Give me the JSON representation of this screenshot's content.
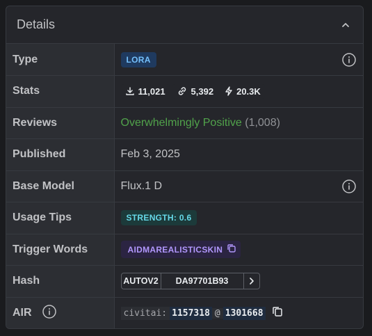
{
  "header": {
    "title": "Details"
  },
  "rows": {
    "type": {
      "label": "Type",
      "badge": "LORA"
    },
    "stats": {
      "label": "Stats",
      "downloads": "11,021",
      "links": "5,392",
      "buzz": "20.3K"
    },
    "reviews": {
      "label": "Reviews",
      "rating": "Overwhelmingly Positive",
      "count": "(1,008)"
    },
    "published": {
      "label": "Published",
      "date": "Feb 3, 2025"
    },
    "base_model": {
      "label": "Base Model",
      "value": "Flux.1 D"
    },
    "usage_tips": {
      "label": "Usage Tips",
      "badge": "STRENGTH: 0.6"
    },
    "trigger_words": {
      "label": "Trigger Words",
      "word": "AIDMAREALISTICSKIN"
    },
    "hash": {
      "label": "Hash",
      "type": "AUTOV2",
      "value": "DA97701B93"
    },
    "air": {
      "label": "AIR",
      "prefix": "civitai:",
      "model_id": "1157318",
      "at": "@",
      "version_id": "1301668"
    }
  },
  "colors": {
    "positive": "#51a34b",
    "lora_badge_bg": "#1f3a5f",
    "strength_badge_bg": "#1c3a3a",
    "trigger_badge_bg": "#2b2442"
  },
  "icons": [
    "chevron-up-icon",
    "info-icon",
    "download-icon",
    "link-icon",
    "bolt-icon",
    "copy-icon",
    "chevron-right-icon"
  ]
}
